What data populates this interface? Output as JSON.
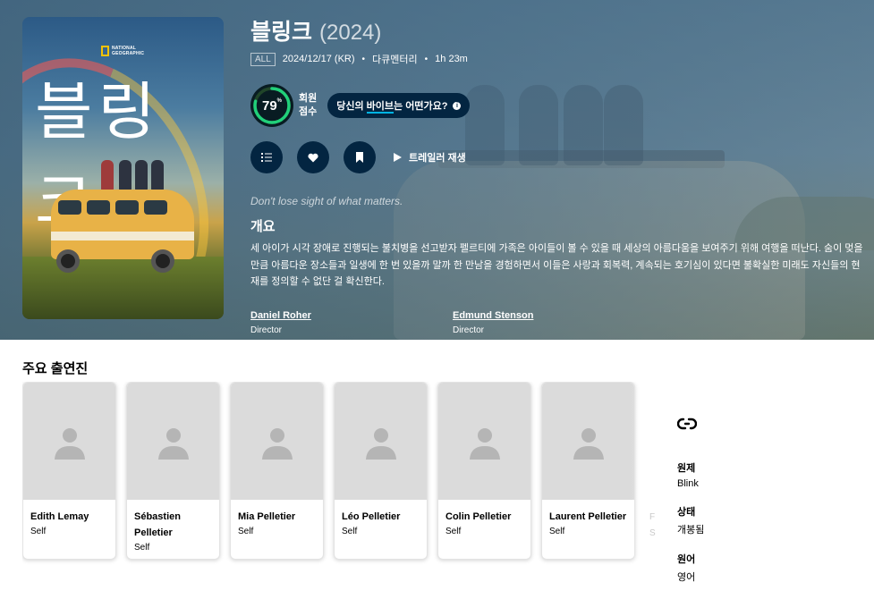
{
  "hero": {
    "poster": {
      "brand_line1": "NATIONAL",
      "brand_line2": "GEOGRAPHIC",
      "title_art": "블링크"
    },
    "title": "블링크",
    "year": "(2024)",
    "certification": "ALL",
    "release": "2024/12/17 (KR)",
    "genre": "다큐멘터리",
    "runtime": "1h 23m",
    "score": {
      "value": "79",
      "percent_sign": "%",
      "fraction": 0.79,
      "label_line1": "회원",
      "label_line2": "점수",
      "ring_color": "#21d07a",
      "track_color": "#204529"
    },
    "vibe": {
      "prefix": "당신의 ",
      "highlight": "바이브",
      "suffix": "는 어떤가요?",
      "info_icon": "i"
    },
    "actions": {
      "list_icon": "list-icon",
      "favorite_icon": "heart-icon",
      "watchlist_icon": "bookmark-icon",
      "trailer_label": "트레일러 재생"
    },
    "tagline": "Don't lose sight of what matters.",
    "overview_heading": "개요",
    "overview": "세 아이가 시각 장애로 진행되는 불치병을 선고받자 펠르티에 가족은 아이들이 볼 수 있을 때 세상의 아름다움을 보여주기 위해 여행을 떠난다. 숨이 멎을 만큼 아름다운 장소들과 일생에 한 번 있을까 말까 한 만남을 경험하면서 이들은 사랑과 회복력, 계속되는 호기심이 있다면 불확실한 미래도 자신들의 현재를 정의할 수 없단 걸 확신한다.",
    "crew": [
      {
        "name": "Daniel Roher",
        "job": "Director"
      },
      {
        "name": "Edmund Stenson",
        "job": "Director"
      }
    ]
  },
  "cast": {
    "heading": "주요 출연진",
    "members": [
      {
        "name": "Edith Lemay",
        "character": "Self"
      },
      {
        "name": "Sébastien Pelletier",
        "character": "Self"
      },
      {
        "name": "Mia Pelletier",
        "character": "Self"
      },
      {
        "name": "Léo Pelletier",
        "character": "Self"
      },
      {
        "name": "Colin Pelletier",
        "character": "Self"
      },
      {
        "name": "Laurent Pelletier",
        "character": "Self"
      }
    ],
    "partial_next": {
      "name": "F",
      "character": "S"
    }
  },
  "sidebar": {
    "link_icon": "link-icon",
    "facts": [
      {
        "key": "원제",
        "value": "Blink"
      },
      {
        "key": "상태",
        "value": "개봉됨"
      },
      {
        "key": "원어",
        "value": "영어"
      }
    ]
  },
  "colors": {
    "accent_dark": "#032541",
    "accent_light": "#01b4e4"
  }
}
